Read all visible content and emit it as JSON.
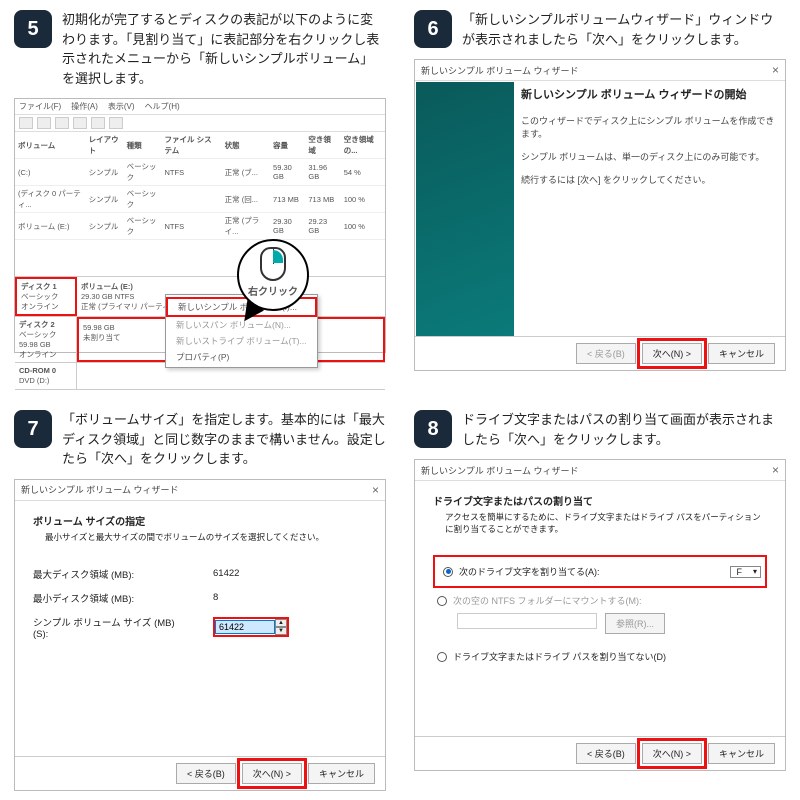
{
  "steps": {
    "s5": {
      "num": "5",
      "text": "初期化が完了するとディスクの表記が以下のように変わります。「見割り当て」に表記部分を右クリックし表示されたメニューから「新しいシンプルボリューム」を選択します。",
      "menubar": [
        "ファイル(F)",
        "操作(A)",
        "表示(V)",
        "ヘルプ(H)"
      ],
      "cols": [
        "ボリューム",
        "レイアウト",
        "種類",
        "ファイル システム",
        "状態",
        "容量",
        "空き領域",
        "空き領域の..."
      ],
      "rows": [
        [
          "(C:)",
          "シンプル",
          "ベーシック",
          "NTFS",
          "正常 (ブ...",
          "59.30 GB",
          "31.96 GB",
          "54 %"
        ],
        [
          "(ディスク 0 パーティ...",
          "シンプル",
          "ベーシック",
          "",
          "正常 (回...",
          "713 MB",
          "713 MB",
          "100 %"
        ],
        [
          "ボリューム (E:)",
          "シンプル",
          "ベーシック",
          "NTFS",
          "正常 (プライ...",
          "29.30 GB",
          "29.23 GB",
          "100 %"
        ]
      ],
      "disk1": {
        "name": "ディスク 1",
        "sub1": "ベーシック",
        "sub3": "オンライン",
        "vol": "ボリューム (E:)",
        "size": "29.30 GB NTFS",
        "stat": "正常 (プライマリ パーティション)"
      },
      "disk2": {
        "name": "ディスク 2",
        "sub1": "ベーシック",
        "size": "59.98 GB",
        "sub3": "オンライン",
        "body1": "59.98 GB",
        "body2": "未割り当て"
      },
      "cd": {
        "name": "CD-ROM 0",
        "sub": "DVD (D:)"
      },
      "menu": {
        "i1": "新しいシンプル ボリューム(I)...",
        "i2": "新しいスパン ボリューム(N)...",
        "i3": "新しいストライプ ボリューム(T)...",
        "i4": "プロパティ(P)"
      },
      "callout": "右クリック"
    },
    "s6": {
      "num": "6",
      "text": "「新しいシンプルボリュームウィザード」ウィンドウが表示されましたら「次へ」をクリックします。",
      "title": "新しいシンプル ボリューム ウィザード",
      "h": "新しいシンプル ボリューム ウィザードの開始",
      "p1": "このウィザードでディスク上にシンプル ボリュームを作成できます。",
      "p2": "シンプル ボリュームは、単一のディスク上にのみ可能です。",
      "p3": "続行するには [次へ] をクリックしてください。",
      "back": "< 戻る(B)",
      "next": "次へ(N) >",
      "cancel": "キャンセル"
    },
    "s7": {
      "num": "7",
      "text": "「ボリュームサイズ」を指定します。基本的には「最大ディスク領域」と同じ数字のままで構いません。設定したら「次へ」をクリックします。",
      "title": "新しいシンプル ボリューム ウィザード",
      "h": "ボリューム サイズの指定",
      "sub": "最小サイズと最大サイズの間でボリュームのサイズを選択してください。",
      "maxl": "最大ディスク領域 (MB):",
      "maxv": "61422",
      "minl": "最小ディスク領域 (MB):",
      "minv": "8",
      "szl": "シンプル ボリューム サイズ (MB)(S):",
      "szv": "61422",
      "back": "< 戻る(B)",
      "next": "次へ(N) >",
      "cancel": "キャンセル"
    },
    "s8": {
      "num": "8",
      "text": "ドライブ文字またはパスの割り当て画面が表示されましたら「次へ」をクリックします。",
      "title": "新しいシンプル ボリューム ウィザード",
      "h": "ドライブ文字またはパスの割り当て",
      "sub": "アクセスを簡単にするために、ドライブ文字またはドライブ パスをパーティションに割り当てることができます。",
      "opt1": "次のドライブ文字を割り当てる(A):",
      "drive": "F",
      "opt2": "次の空の NTFS フォルダーにマウントする(M):",
      "browse": "参照(R)...",
      "opt3": "ドライブ文字またはドライブ パスを割り当てない(D)",
      "back": "< 戻る(B)",
      "next": "次へ(N) >",
      "cancel": "キャンセル"
    }
  }
}
